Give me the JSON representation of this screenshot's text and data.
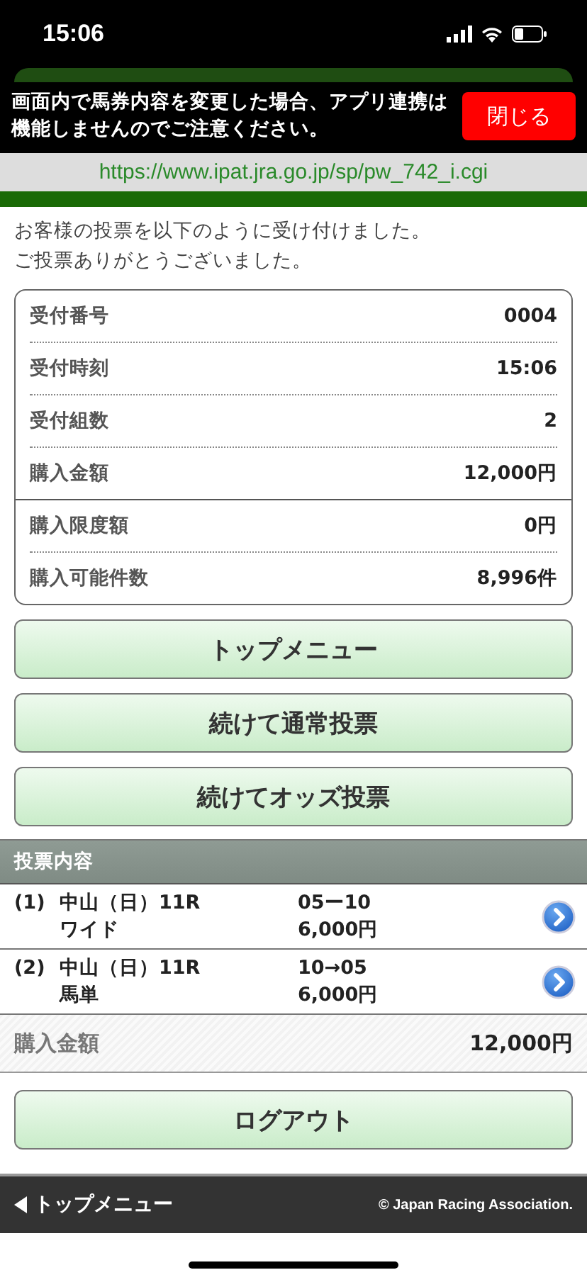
{
  "status_bar": {
    "time": "15:06"
  },
  "banner": {
    "message": "画面内で馬券内容を変更した場合、アプリ連携は機能しませんのでご注意ください。",
    "close_button": "閉じる"
  },
  "url_bar": {
    "url": "https://www.ipat.jra.go.jp/sp/pw_742_i.cgi"
  },
  "message": [
    "お客様の投票を以下のように受け付けました。",
    "ご投票ありがとうございました。"
  ],
  "summary": {
    "groups": [
      [
        {
          "label": "受付番号",
          "value": "0004"
        },
        {
          "label": "受付時刻",
          "value": "15:06"
        },
        {
          "label": "受付組数",
          "value": "2"
        },
        {
          "label": "購入金額",
          "value": "12,000円"
        }
      ],
      [
        {
          "label": "購入限度額",
          "value": "0円"
        },
        {
          "label": "購入可能件数",
          "value": "8,996件"
        }
      ]
    ]
  },
  "buttons": [
    "トップメニュー",
    "続けて通常投票",
    "続けてオッズ投票"
  ],
  "bets": {
    "title": "投票内容",
    "rows": [
      {
        "index": "(1)",
        "race": "中山（日）11R",
        "type": "ワイド",
        "numbers": "05ー10",
        "amount": "6,000円"
      },
      {
        "index": "(2)",
        "race": "中山（日）11R",
        "type": "馬単",
        "numbers": "10→05",
        "amount": "6,000円"
      }
    ],
    "total_label": "購入金額",
    "total_value": "12,000円"
  },
  "logout_button": "ログアウト",
  "footer": {
    "back_link": "トップメニュー",
    "copyright": "© Japan Racing Association."
  }
}
